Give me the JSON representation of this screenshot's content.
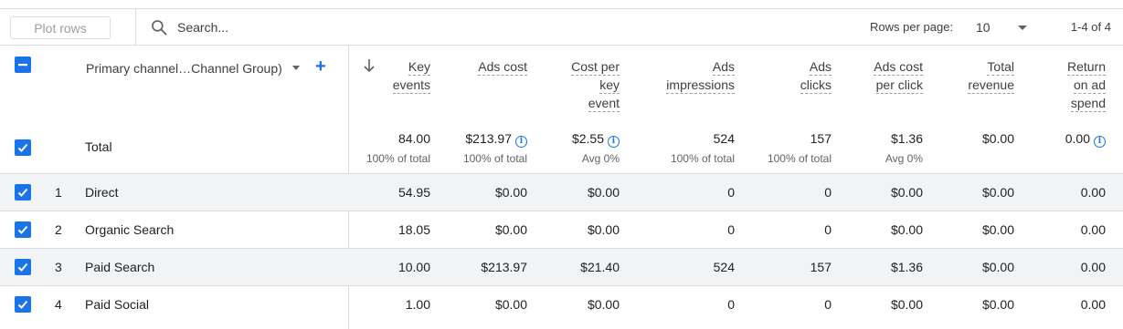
{
  "toolbar": {
    "plot_rows_label": "Plot rows",
    "search_placeholder": "Search...",
    "rows_per_page_label": "Rows per page:",
    "rows_per_page_value": "10",
    "range_text": "1-4 of 4"
  },
  "table": {
    "dimension_header": "Primary channel…Channel Group)",
    "columns": [
      {
        "lines": [
          "Key",
          "events"
        ]
      },
      {
        "lines": [
          "Ads cost"
        ]
      },
      {
        "lines": [
          "Cost per",
          "key",
          "event"
        ]
      },
      {
        "lines": [
          "Ads",
          "impressions"
        ]
      },
      {
        "lines": [
          "Ads",
          "clicks"
        ]
      },
      {
        "lines": [
          "Ads cost",
          "per click"
        ]
      },
      {
        "lines": [
          "Total",
          "revenue"
        ]
      },
      {
        "lines": [
          "Return",
          "on ad",
          "spend"
        ]
      }
    ],
    "total": {
      "label": "Total",
      "values": [
        "84.00",
        "$213.97",
        "$2.55",
        "524",
        "157",
        "$1.36",
        "$0.00",
        "0.00"
      ],
      "subs": [
        "100% of total",
        "100% of total",
        "Avg 0%",
        "100% of total",
        "100% of total",
        "Avg 0%",
        "",
        ""
      ]
    },
    "rows": [
      {
        "num": "1",
        "name": "Direct",
        "values": [
          "54.95",
          "$0.00",
          "$0.00",
          "0",
          "0",
          "$0.00",
          "$0.00",
          "0.00"
        ]
      },
      {
        "num": "2",
        "name": "Organic Search",
        "values": [
          "18.05",
          "$0.00",
          "$0.00",
          "0",
          "0",
          "$0.00",
          "$0.00",
          "0.00"
        ]
      },
      {
        "num": "3",
        "name": "Paid Search",
        "values": [
          "10.00",
          "$213.97",
          "$21.40",
          "524",
          "157",
          "$1.36",
          "$0.00",
          "0.00"
        ]
      },
      {
        "num": "4",
        "name": "Paid Social",
        "values": [
          "1.00",
          "$0.00",
          "$0.00",
          "0",
          "0",
          "$0.00",
          "$0.00",
          "0.00"
        ]
      }
    ]
  },
  "colors": {
    "accent": "#1a73e8",
    "shaded_row": "#f1f3f4",
    "border": "#dadce0"
  }
}
